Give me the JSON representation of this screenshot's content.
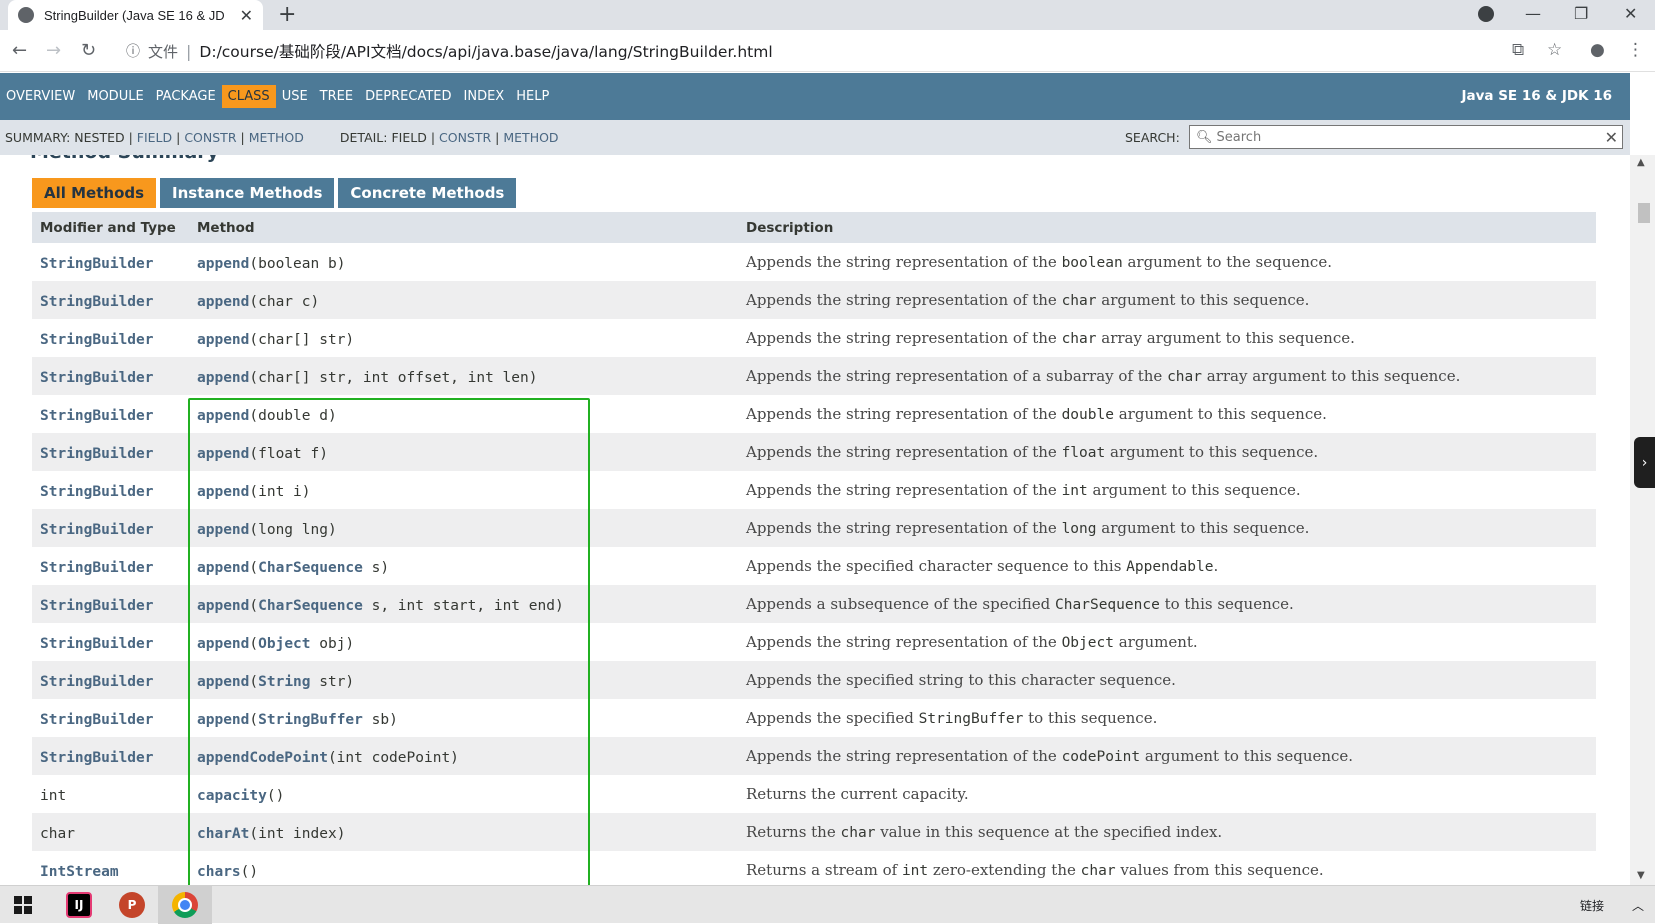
{
  "browser": {
    "tab_title": "StringBuilder (Java SE 16 & JD",
    "tab_close": "✕",
    "new_tab": "+",
    "address_prefix": "文件",
    "url": "D:/course/基础阶段/API文档/docs/api/java.base/java/lang/StringBuilder.html"
  },
  "nav": {
    "items": [
      "OVERVIEW",
      "MODULE",
      "PACKAGE",
      "CLASS",
      "USE",
      "TREE",
      "DEPRECATED",
      "INDEX",
      "HELP"
    ],
    "active": "CLASS",
    "brand": "Java SE 16 & JDK 16"
  },
  "subnav": {
    "summary_label": "SUMMARY:",
    "summary_nested": "NESTED",
    "summary_field": "FIELD",
    "summary_constr": "CONSTR",
    "summary_method": "METHOD",
    "detail_label": "DETAIL:",
    "detail_field": "FIELD",
    "detail_constr": "CONSTR",
    "detail_method": "METHOD",
    "search_label": "SEARCH:",
    "search_placeholder": "Search"
  },
  "method_tabs": [
    "All Methods",
    "Instance Methods",
    "Concrete Methods"
  ],
  "table": {
    "headers": [
      "Modifier and Type",
      "Method",
      "Description"
    ],
    "rows": [
      {
        "type": "StringBuilder",
        "type_link": true,
        "name": "append",
        "params": "(boolean b)",
        "desc": [
          [
            "Appends the string representation of the ",
            false
          ],
          [
            "boolean",
            true
          ],
          [
            " argument to the sequence.",
            false
          ]
        ]
      },
      {
        "type": "StringBuilder",
        "type_link": true,
        "name": "append",
        "params": "(char c)",
        "desc": [
          [
            "Appends the string representation of the ",
            false
          ],
          [
            "char",
            true
          ],
          [
            " argument to this sequence.",
            false
          ]
        ]
      },
      {
        "type": "StringBuilder",
        "type_link": true,
        "name": "append",
        "params": "(char[] str)",
        "desc": [
          [
            "Appends the string representation of the ",
            false
          ],
          [
            "char",
            true
          ],
          [
            " array argument to this sequence.",
            false
          ]
        ]
      },
      {
        "type": "StringBuilder",
        "type_link": true,
        "name": "append",
        "params": "(char[] str, int offset, int len)",
        "desc": [
          [
            "Appends the string representation of a subarray of the ",
            false
          ],
          [
            "char",
            true
          ],
          [
            " array argument to this sequence.",
            false
          ]
        ]
      },
      {
        "type": "StringBuilder",
        "type_link": true,
        "name": "append",
        "params": "(double d)",
        "desc": [
          [
            "Appends the string representation of the ",
            false
          ],
          [
            "double",
            true
          ],
          [
            " argument to this sequence.",
            false
          ]
        ]
      },
      {
        "type": "StringBuilder",
        "type_link": true,
        "name": "append",
        "params": "(float f)",
        "desc": [
          [
            "Appends the string representation of the ",
            false
          ],
          [
            "float",
            true
          ],
          [
            " argument to this sequence.",
            false
          ]
        ]
      },
      {
        "type": "StringBuilder",
        "type_link": true,
        "name": "append",
        "params": "(int i)",
        "desc": [
          [
            "Appends the string representation of the ",
            false
          ],
          [
            "int",
            true
          ],
          [
            " argument to this sequence.",
            false
          ]
        ]
      },
      {
        "type": "StringBuilder",
        "type_link": true,
        "name": "append",
        "params": "(long lng)",
        "desc": [
          [
            "Appends the string representation of the ",
            false
          ],
          [
            "long",
            true
          ],
          [
            " argument to this sequence.",
            false
          ]
        ]
      },
      {
        "type": "StringBuilder",
        "type_link": true,
        "name": "append",
        "params_parts": [
          [
            "(",
            false
          ],
          [
            "CharSequence",
            true
          ],
          [
            " s)",
            false
          ]
        ],
        "desc": [
          [
            "Appends the specified character sequence to this ",
            false
          ],
          [
            "Appendable",
            true
          ],
          [
            ".",
            false
          ]
        ]
      },
      {
        "type": "StringBuilder",
        "type_link": true,
        "name": "append",
        "params_parts": [
          [
            "(",
            false
          ],
          [
            "CharSequence",
            true
          ],
          [
            " s, int start, int end)",
            false
          ]
        ],
        "desc": [
          [
            "Appends a subsequence of the specified ",
            false
          ],
          [
            "CharSequence",
            true
          ],
          [
            " to this sequence.",
            false
          ]
        ]
      },
      {
        "type": "StringBuilder",
        "type_link": true,
        "name": "append",
        "params_parts": [
          [
            "(",
            false
          ],
          [
            "Object",
            true
          ],
          [
            " obj)",
            false
          ]
        ],
        "desc": [
          [
            "Appends the string representation of the ",
            false
          ],
          [
            "Object",
            true
          ],
          [
            " argument.",
            false
          ]
        ]
      },
      {
        "type": "StringBuilder",
        "type_link": true,
        "name": "append",
        "params_parts": [
          [
            "(",
            false
          ],
          [
            "String",
            true
          ],
          [
            " str)",
            false
          ]
        ],
        "desc": [
          [
            "Appends the specified string to this character sequence.",
            false
          ]
        ]
      },
      {
        "type": "StringBuilder",
        "type_link": true,
        "name": "append",
        "params_parts": [
          [
            "(",
            false
          ],
          [
            "StringBuffer",
            true
          ],
          [
            " sb)",
            false
          ]
        ],
        "desc": [
          [
            "Appends the specified ",
            false
          ],
          [
            "StringBuffer",
            true
          ],
          [
            " to this sequence.",
            false
          ]
        ]
      },
      {
        "type": "StringBuilder",
        "type_link": true,
        "name": "appendCodePoint",
        "params": "(int codePoint)",
        "desc": [
          [
            "Appends the string representation of the ",
            false
          ],
          [
            "codePoint",
            true
          ],
          [
            " argument to this sequence.",
            false
          ]
        ]
      },
      {
        "type": "int",
        "type_link": false,
        "name": "capacity",
        "params": "()",
        "desc": [
          [
            "Returns the current capacity.",
            false
          ]
        ]
      },
      {
        "type": "char",
        "type_link": false,
        "name": "charAt",
        "params": "(int index)",
        "desc": [
          [
            "Returns the ",
            false
          ],
          [
            "char",
            true
          ],
          [
            " value in this sequence at the specified index.",
            false
          ]
        ]
      },
      {
        "type": "IntStream",
        "type_link": true,
        "name": "chars",
        "params": "()",
        "desc": [
          [
            "Returns a stream of ",
            false
          ],
          [
            "int",
            true
          ],
          [
            " zero-extending the ",
            false
          ],
          [
            "char",
            true
          ],
          [
            " values from this sequence.",
            false
          ]
        ]
      }
    ]
  },
  "taskbar": {
    "right_label": "链接"
  },
  "colors": {
    "nav_bg": "#4d7a97",
    "active_tab": "#f8981d",
    "link": "#4a6782",
    "highlight_box": "#21b021"
  }
}
